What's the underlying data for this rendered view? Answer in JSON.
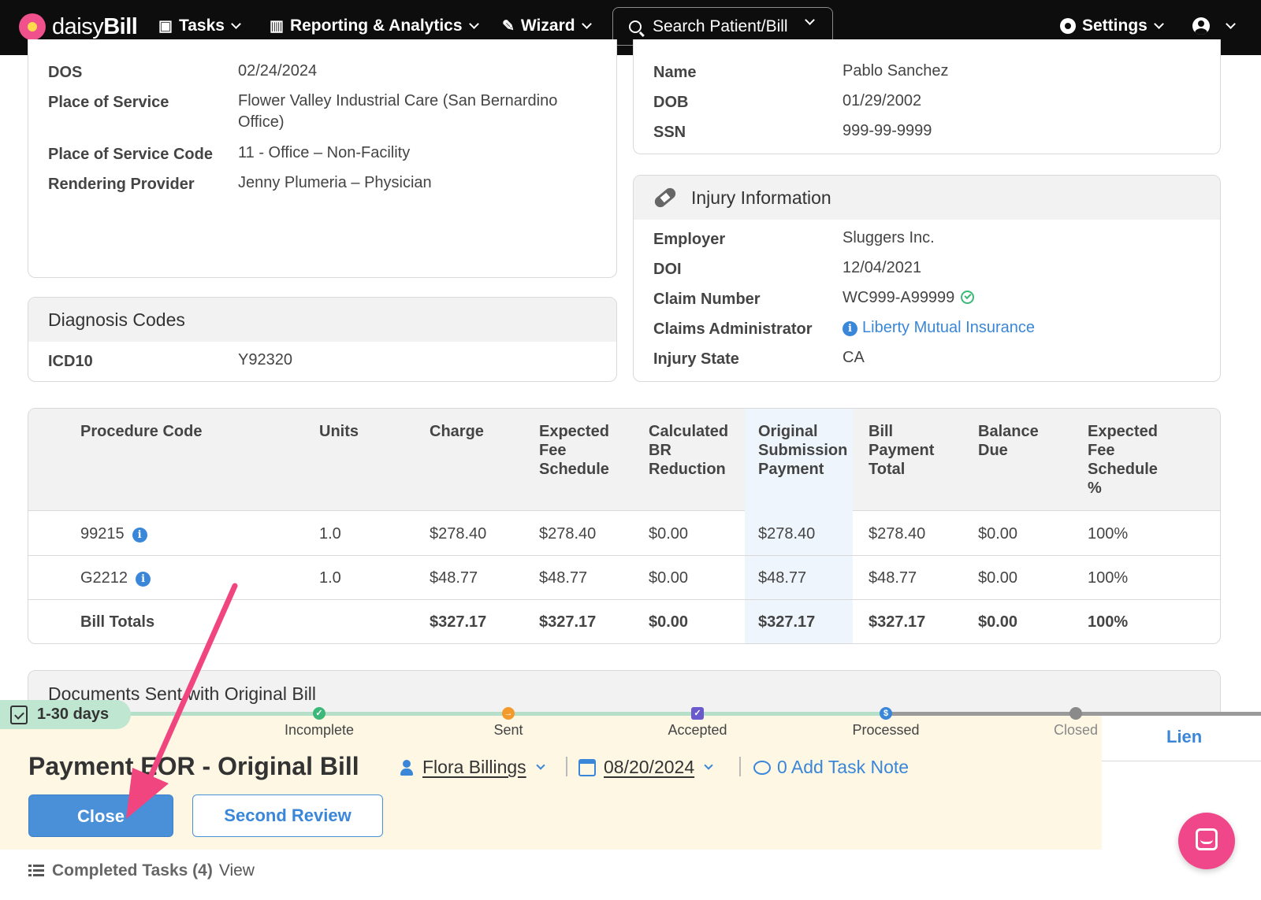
{
  "nav": {
    "logo_text_a": "daisy",
    "logo_text_b": "Bill",
    "tasks": "Tasks",
    "reporting": "Reporting & Analytics",
    "wizard": "Wizard",
    "search_placeholder": "Search Patient/Bill",
    "settings": "Settings"
  },
  "bill_info": {
    "rows": [
      {
        "label": "DOS",
        "value": "02/24/2024"
      },
      {
        "label": "Place of Service",
        "value": "Flower Valley Industrial Care (San Bernardino Office)"
      },
      {
        "label": "Place of Service Code",
        "value": "11 - Office – Non-Facility"
      },
      {
        "label": "Rendering Provider",
        "value": "Jenny Plumeria – Physician"
      }
    ]
  },
  "patient": {
    "rows": [
      {
        "label": "Name",
        "value": "Pablo Sanchez"
      },
      {
        "label": "DOB",
        "value": "01/29/2002"
      },
      {
        "label": "SSN",
        "value": "999-99-9999"
      }
    ]
  },
  "injury": {
    "title": "Injury Information",
    "rows": [
      {
        "label": "Employer",
        "value": "Sluggers Inc."
      },
      {
        "label": "DOI",
        "value": "12/04/2021"
      },
      {
        "label": "Claim Number",
        "value": "WC999-A99999"
      },
      {
        "label": "Claims Administrator",
        "value": "Liberty Mutual Insurance"
      },
      {
        "label": "Injury State",
        "value": "CA"
      }
    ]
  },
  "diagnosis": {
    "title": "Diagnosis Codes",
    "label": "ICD10",
    "value": "Y92320"
  },
  "procedures": {
    "headers": [
      "Procedure Code",
      "Units",
      "Charge",
      "Expected Fee Schedule",
      "Calculated BR Reduction",
      "Original Submission Payment",
      "Bill Payment Total",
      "Balance Due",
      "Expected Fee Schedule %"
    ],
    "rows": [
      [
        "99215",
        "1.0",
        "$278.40",
        "$278.40",
        "$0.00",
        "$278.40",
        "$278.40",
        "$0.00",
        "100%"
      ],
      [
        "G2212",
        "1.0",
        "$48.77",
        "$48.77",
        "$0.00",
        "$48.77",
        "$48.77",
        "$0.00",
        "100%"
      ]
    ],
    "totals": [
      "Bill Totals",
      "",
      "$327.17",
      "$327.17",
      "$0.00",
      "$327.17",
      "$327.17",
      "$0.00",
      "100%"
    ]
  },
  "documents": {
    "title": "Documents Sent with Original Bill"
  },
  "task": {
    "days_badge": "1-30 days",
    "steps": [
      "Incomplete",
      "Sent",
      "Accepted",
      "Processed",
      "Closed"
    ],
    "lien_tab": "Lien",
    "title": "Payment EOR - Original Bill",
    "assignee": "Flora Billings",
    "due_date": "08/20/2024",
    "note_link": "0 Add Task Note",
    "close_btn": "Close",
    "second_review_btn": "Second Review"
  },
  "completed": {
    "label": "Completed Tasks (4)",
    "view": "View"
  },
  "colors": {
    "accent": "#4a90d9",
    "arrow": "#f0457f",
    "step_incomplete": "#3cb878",
    "step_sent": "#f39a2c",
    "step_accepted": "#6a5acd",
    "step_processed": "#3a86d8",
    "step_closed": "#8a8a8a"
  }
}
